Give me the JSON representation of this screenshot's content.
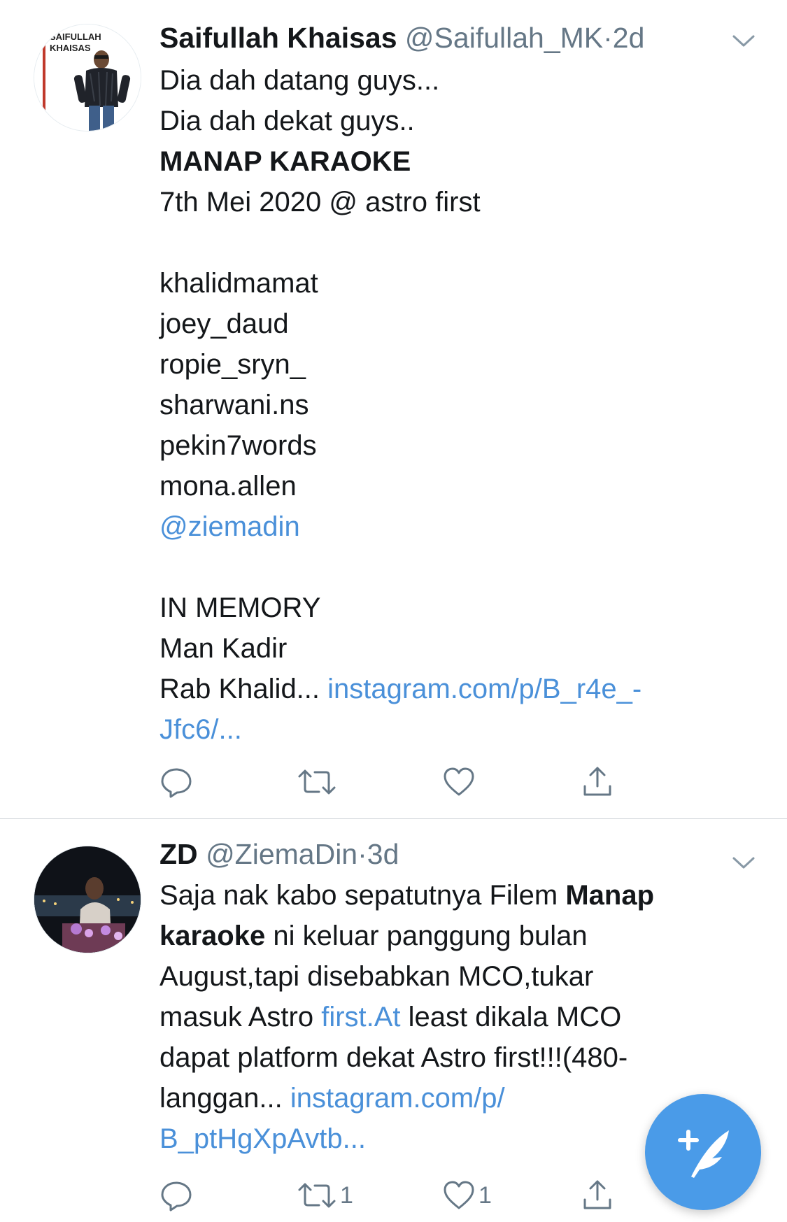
{
  "tweets": [
    {
      "avatar_text": [
        "SAIFULLAH",
        "KHAISAS"
      ],
      "name": "Saifullah Khaisas",
      "handle": "@Saifullah_MK",
      "separator": "·",
      "time": "2d",
      "lines": [
        "Dia dah datang guys...",
        "Dia dah dekat guys..",
        "MANAP KARAOKE",
        "7th Mei 2020 @ astro first",
        "",
        "khalidmamat",
        "joey_daud",
        "ropie_sryn_",
        "sharwani.ns",
        "pekin7words",
        "mona.allen",
        "@ziemadin",
        "",
        "IN MEMORY",
        "Man Kadir"
      ],
      "last_line_text": "Rab Khalid... ",
      "link_part1": "instagram.com/p/B_r4e_-",
      "link_part2": "Jfc6/...",
      "retweet_count": "",
      "like_count": ""
    },
    {
      "name": "ZD",
      "handle": "@ZiemaDin",
      "separator": "·",
      "time": "3d",
      "l1_text": "Saja nak kabo sepatutnya Filem ",
      "l1_bold": "Manap",
      "l2_bold": "karaoke",
      "l2_text": " ni keluar panggung bulan",
      "l3": "August,tapi disebabkan MCO,tukar",
      "l4_text": "masuk Astro ",
      "l4_link": "first.At",
      "l4_text2": " least dikala MCO",
      "l5": "dapat platform dekat Astro first!!!(480-",
      "l6_text": "langgan... ",
      "l6_link": "instagram.com/p/",
      "l7_link": "B_ptHgXpAvtb...",
      "retweet_count": "1",
      "like_count": "1"
    }
  ],
  "icons": {
    "reply": "reply-icon",
    "retweet": "retweet-icon",
    "like": "heart-icon",
    "share": "share-icon",
    "compose": "compose-tweet-icon",
    "caret": "chevron-down-icon"
  },
  "colors": {
    "link": "#4a90d9",
    "meta": "#657786",
    "fab": "#4a9be8"
  }
}
